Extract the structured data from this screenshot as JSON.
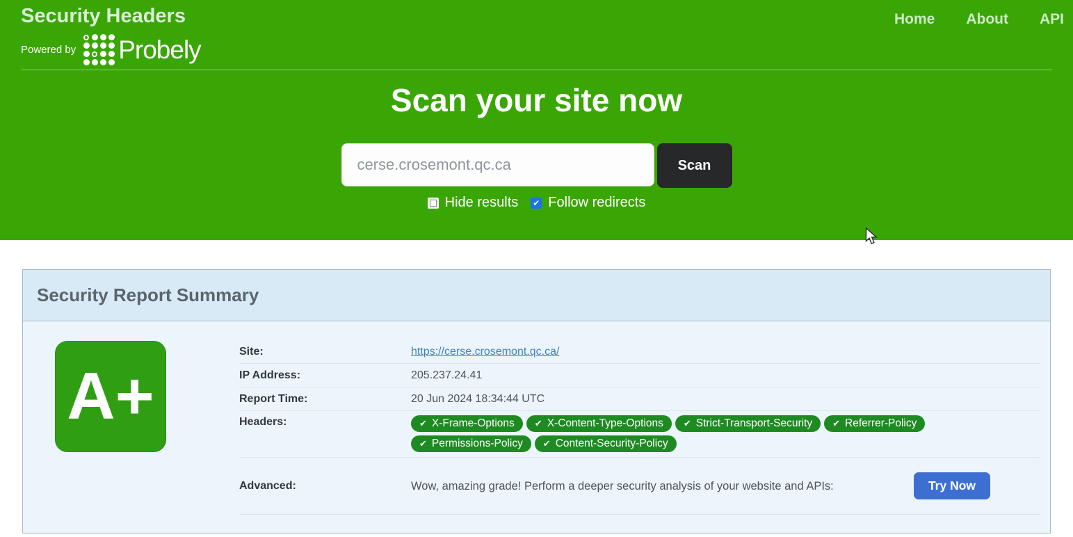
{
  "icons": {
    "check": "✔"
  },
  "colors": {
    "green_background": "#3aa606",
    "pill_green": "#1e8b22",
    "badge_green": "#2f9e13",
    "scan_button_dark": "#26282a",
    "try_now_blue": "#3d6fd2",
    "link_blue": "#3d7fc2",
    "checkbox_blue": "#1a73e8",
    "panel_heading_blue": "#d9eaf7",
    "panel_body_blue": "#edf5fc"
  },
  "header": {
    "title": "Security Headers",
    "powered_by": "Powered by",
    "logo_text": "Probely",
    "nav": [
      {
        "label": "Home"
      },
      {
        "label": "About"
      },
      {
        "label": "API"
      }
    ]
  },
  "hero": {
    "title": "Scan your site now",
    "input_value": "cerse.crosemont.qc.ca",
    "scan_label": "Scan",
    "checkboxes": [
      {
        "label": "Hide results",
        "checked": false
      },
      {
        "label": "Follow redirects",
        "checked": true
      }
    ]
  },
  "report": {
    "heading": "Security Report Summary",
    "grade": "A+",
    "rows": {
      "site": {
        "label": "Site:",
        "value": "https://cerse.crosemont.qc.ca/"
      },
      "ip": {
        "label": "IP Address:",
        "value": "205.237.24.41"
      },
      "report_time": {
        "label": "Report Time:",
        "value": "20 Jun 2024 18:34:44 UTC"
      },
      "headers": {
        "label": "Headers:",
        "pills": [
          "X-Frame-Options",
          "X-Content-Type-Options",
          "Strict-Transport-Security",
          "Referrer-Policy",
          "Permissions-Policy",
          "Content-Security-Policy"
        ]
      },
      "advanced": {
        "label": "Advanced:",
        "text": "Wow, amazing grade! Perform a deeper security analysis of your website and APIs:",
        "button": "Try Now"
      }
    }
  }
}
